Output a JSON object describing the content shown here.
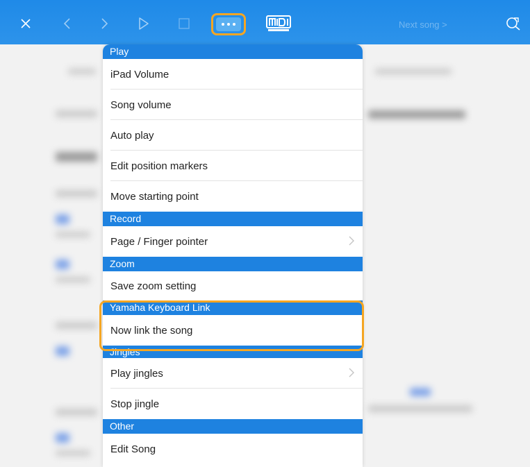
{
  "toolbar": {
    "close_icon": "close-icon",
    "back_icon": "chevron-left-icon",
    "forward_icon": "chevron-right-icon",
    "play_icon": "play-icon",
    "stop_icon": "stop-icon",
    "more_icon": "more-icon",
    "midi_logo": "midi-logo",
    "next_song_label": "Next song >",
    "settings_icon": "search-settings-icon",
    "accent_color": "#1f8ae8",
    "highlight_color": "#f5a623"
  },
  "menu": {
    "sections": [
      {
        "title": "Play",
        "items": [
          {
            "label": "iPad Volume"
          },
          {
            "label": "Song volume"
          },
          {
            "label": "Auto play"
          },
          {
            "label": "Edit position markers"
          },
          {
            "label": "Move starting point"
          }
        ]
      },
      {
        "title": "Record",
        "items": [
          {
            "label": "Page / Finger pointer",
            "chevron": true
          }
        ]
      },
      {
        "title": "Zoom",
        "items": [
          {
            "label": "Save zoom setting"
          }
        ]
      },
      {
        "title": "Yamaha Keyboard Link",
        "items": [
          {
            "label": "Now link the song"
          }
        ]
      },
      {
        "title": "Jingles",
        "items": [
          {
            "label": "Play jingles",
            "chevron": true
          },
          {
            "label": "Stop jingle"
          }
        ]
      },
      {
        "title": "Other",
        "items": [
          {
            "label": "Edit Song"
          }
        ]
      }
    ]
  }
}
